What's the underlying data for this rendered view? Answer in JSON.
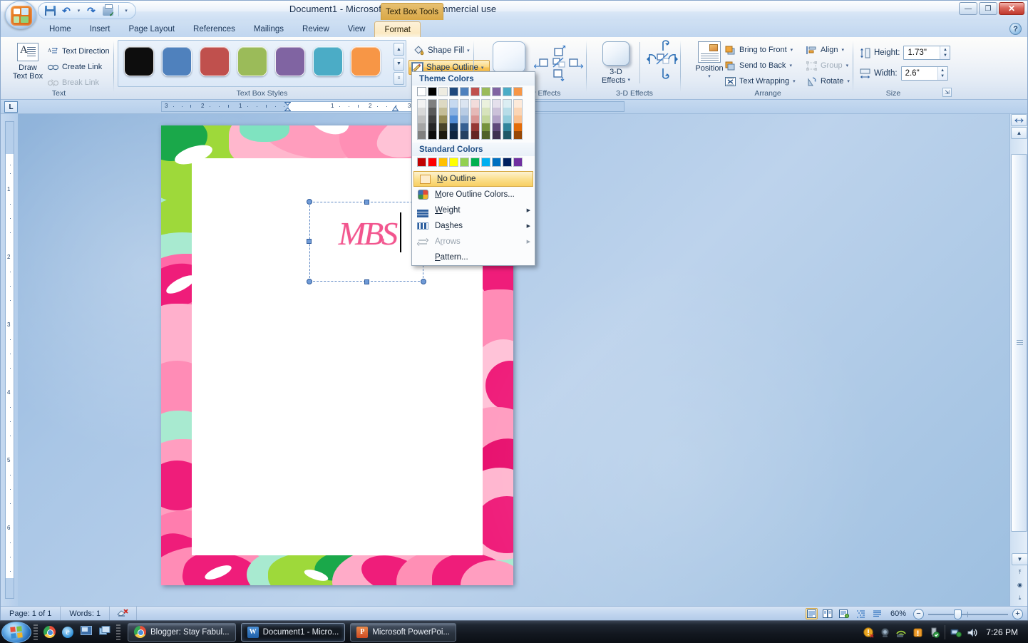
{
  "window": {
    "title": "Document1  -  Microsoft Word non-commercial use",
    "contextual_tab": "Text Box Tools",
    "minimize_label": "—",
    "restore_label": "❐",
    "close_label": "✕",
    "help_label": "?"
  },
  "quick_access": {
    "save_label": "save-icon",
    "undo_label": "↶",
    "undo_dropdown": "▾",
    "redo_label": "↷",
    "print_preview_label": "print-preview-icon",
    "customize_label": "▾"
  },
  "ribbon": {
    "tabs": [
      {
        "label": "Home",
        "active": false
      },
      {
        "label": "Insert",
        "active": false
      },
      {
        "label": "Page Layout",
        "active": false
      },
      {
        "label": "References",
        "active": false
      },
      {
        "label": "Mailings",
        "active": false
      },
      {
        "label": "Review",
        "active": false
      },
      {
        "label": "View",
        "active": false
      },
      {
        "label": "Format",
        "active": true
      }
    ],
    "groups": {
      "text": {
        "label": "Text",
        "draw_text_box": "Draw\nText Box",
        "draw_text_box_line1": "Draw",
        "draw_text_box_line2": "Text Box",
        "items": [
          {
            "label": "Text Direction",
            "disabled": false
          },
          {
            "label": "Create Link",
            "disabled": false
          },
          {
            "label": "Break Link",
            "disabled": true
          }
        ]
      },
      "text_box_styles": {
        "label": "Text Box Styles",
        "swatches": [
          "#0d0d0d",
          "#4f81bd",
          "#c0504d",
          "#9bbb59",
          "#8064a2",
          "#4bacc6",
          "#f79646"
        ],
        "scroll_up": "▲",
        "scroll_down": "▼",
        "scroll_more": "▾"
      },
      "shape_controls": {
        "shape_fill": "Shape Fill",
        "shape_outline": "Shape Outline",
        "dropdown_arrow": "▾"
      },
      "shadow_effects": {
        "label": "Shadow Effects",
        "label_visible": "w Effects",
        "button": "Shadow"
      },
      "three_d_effects": {
        "label": "3-D Effects",
        "button_line1": "3-D",
        "button_line2": "Effects",
        "dropdown_arrow": "▾"
      },
      "arrange": {
        "label": "Arrange",
        "position_line1": "Position",
        "position_arrow": "▾",
        "items": [
          {
            "label": "Bring to Front",
            "arrow": "▾"
          },
          {
            "label": "Send to Back",
            "arrow": "▾"
          },
          {
            "label": "Text Wrapping",
            "arrow": "▾"
          },
          {
            "label": "Align",
            "arrow": "▾"
          },
          {
            "label": "Group",
            "arrow": "▾",
            "disabled": true
          },
          {
            "label": "Rotate",
            "arrow": "▾"
          }
        ]
      },
      "size": {
        "label": "Size",
        "height_label": "Height:",
        "height_value": "1.73\"",
        "width_label": "Width:",
        "width_value": "2.6\"",
        "dialog_launcher": "⇲"
      }
    }
  },
  "shape_outline_menu": {
    "theme_colors_header": "Theme Colors",
    "theme_top_row": [
      "#ffffff",
      "#000000",
      "#eeece1",
      "#1f497d",
      "#4f81bd",
      "#c0504d",
      "#9bbb59",
      "#8064a2",
      "#4bacc6",
      "#f79646"
    ],
    "theme_tints": [
      [
        "#f2f2f2",
        "#d8d8d8",
        "#bfbfbf",
        "#a5a5a5",
        "#7f7f7f"
      ],
      [
        "#7f7f7f",
        "#595959",
        "#3f3f3f",
        "#262626",
        "#0c0c0c"
      ],
      [
        "#ddd9c3",
        "#c4bd97",
        "#938953",
        "#494429",
        "#1d1b10"
      ],
      [
        "#c6d9f0",
        "#8db3e2",
        "#538dd5",
        "#16365c",
        "#0f243e"
      ],
      [
        "#dbe5f1",
        "#b8cce4",
        "#95b3d7",
        "#366092",
        "#244061"
      ],
      [
        "#f2dcdb",
        "#e5b9b7",
        "#d99694",
        "#953734",
        "#632423"
      ],
      [
        "#ebf1dd",
        "#d7e3bc",
        "#c3d69b",
        "#76923c",
        "#4f6128"
      ],
      [
        "#e5e0ec",
        "#ccc1d9",
        "#b2a2c7",
        "#5f497a",
        "#3f3151"
      ],
      [
        "#dbeef3",
        "#b7dde8",
        "#92cddc",
        "#31859b",
        "#205867"
      ],
      [
        "#fdeada",
        "#fbd5b5",
        "#fac08f",
        "#e36c09",
        "#974806"
      ]
    ],
    "standard_colors_header": "Standard Colors",
    "standard_colors": [
      "#c00000",
      "#ff0000",
      "#ffc000",
      "#ffff00",
      "#92d050",
      "#00b050",
      "#00b0f0",
      "#0070c0",
      "#002060",
      "#7030a0"
    ],
    "items": [
      {
        "label": "No Outline",
        "icon": "no-outline-swatch",
        "selected": true,
        "submenu": false,
        "disabled": false
      },
      {
        "label": "More Outline Colors...",
        "icon": "palette-icon",
        "selected": false,
        "submenu": false,
        "disabled": false
      },
      {
        "label": "Weight",
        "icon": "weight-lines-icon",
        "selected": false,
        "submenu": true,
        "disabled": false
      },
      {
        "label": "Dashes",
        "icon": "dashes-icon",
        "selected": false,
        "submenu": true,
        "disabled": false
      },
      {
        "label": "Arrows",
        "icon": "arrows-icon",
        "selected": false,
        "submenu": true,
        "disabled": true
      },
      {
        "label": "Pattern...",
        "icon": "",
        "selected": false,
        "submenu": false,
        "disabled": false
      }
    ],
    "submenu_arrow": "▶"
  },
  "ruler": {
    "tab_stop_selector": "L",
    "h_numbers": [
      "3",
      "2",
      "1",
      "1",
      "2",
      "3"
    ],
    "v_numbers": [
      "1",
      "2",
      "3",
      "4",
      "5",
      "6"
    ]
  },
  "document": {
    "monogram_text": "MBS",
    "monogram_color": "#f2558e",
    "page_background": "floral-pink-lilly-print"
  },
  "status_bar": {
    "page_label": "Page: 1 of 1",
    "words_label": "Words: 1",
    "proofing_icon": "spelling-check-icon",
    "view_buttons": [
      {
        "name": "print-layout",
        "glyph": "▤",
        "active": true
      },
      {
        "name": "full-screen-reading",
        "glyph": "▥",
        "active": false
      },
      {
        "name": "web-layout",
        "glyph": "▣",
        "active": false
      },
      {
        "name": "outline",
        "glyph": "▦",
        "active": false
      },
      {
        "name": "draft",
        "glyph": "▧",
        "active": false
      }
    ],
    "zoom_level": "60%",
    "zoom_out": "−",
    "zoom_in": "+"
  },
  "scrollbars": {
    "scroll_up": "▲",
    "scroll_down": "▼",
    "split_handle": "▬",
    "prev_page": "⤒",
    "select_browse_object": "◉",
    "next_page": "⤓"
  },
  "taskbar": {
    "start_label": "Start",
    "quick_launch": [
      {
        "name": "chrome-icon"
      },
      {
        "name": "internet-explorer-icon"
      },
      {
        "name": "show-desktop-icon"
      },
      {
        "name": "switch-windows-icon"
      }
    ],
    "items": [
      {
        "label": "Blogger: Stay Fabul...",
        "icon": "chrome-icon",
        "active": false
      },
      {
        "label": "Document1 - Micro...",
        "icon": "word-icon",
        "active": true
      },
      {
        "label": "Microsoft PowerPoi...",
        "icon": "powerpoint-icon",
        "active": false
      }
    ],
    "tray_icons": [
      "security-alert-icon",
      "webcam-icon",
      "network-wireless-icon",
      "alert-icon",
      "usb-safely-remove-icon",
      "network-icon",
      "volume-icon"
    ],
    "clock": "7:26 PM"
  }
}
